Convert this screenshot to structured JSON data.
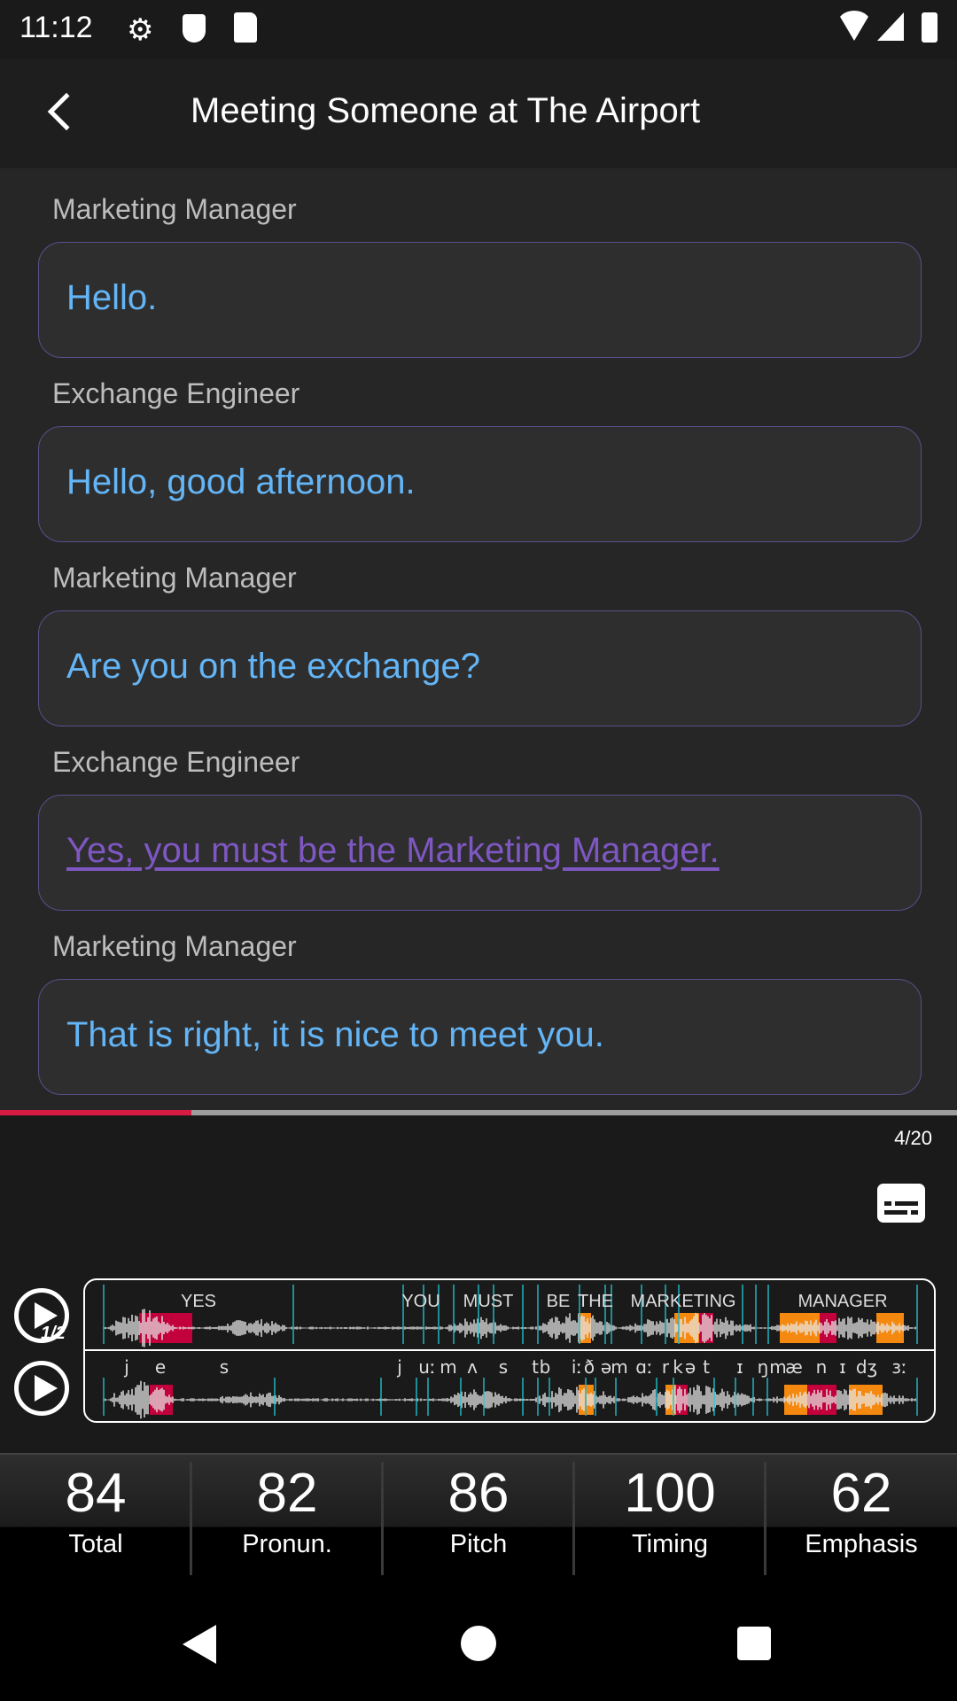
{
  "status_bar": {
    "time": "11:12",
    "icons": [
      "gear-icon",
      "shield-icon",
      "sd-card-icon",
      "wifi-icon",
      "signal-icon",
      "battery-icon"
    ]
  },
  "header": {
    "title": "Meeting Someone at The Airport",
    "back_icon": "chevron-left-icon"
  },
  "dialogue": [
    {
      "speaker": "Marketing Manager",
      "text": "Hello.",
      "active": false
    },
    {
      "speaker": "Exchange Engineer",
      "text": "Hello, good afternoon.",
      "active": false
    },
    {
      "speaker": "Marketing Manager",
      "text": "Are you on the exchange?",
      "active": false
    },
    {
      "speaker": "Exchange Engineer",
      "text": "Yes, you must be the Marketing Manager.",
      "active": true
    },
    {
      "speaker": "Marketing Manager",
      "text": "That is right, it is nice to meet you.",
      "active": false
    }
  ],
  "progress": {
    "current": 4,
    "total": 20,
    "label": "4/20",
    "fraction": 0.2
  },
  "playback": {
    "speed_label": "1/2"
  },
  "waveform": {
    "words": [
      "YES",
      "YOU",
      "MUST",
      "BE",
      "THE",
      "MARKETING",
      "MANAGER"
    ],
    "phonemes": [
      "j",
      "e",
      "s",
      "j",
      "uː",
      "m",
      "ʌ",
      "s",
      "t",
      "b",
      "iː",
      "ð",
      "ə",
      "m",
      "ɑː",
      "r",
      "k",
      "ə",
      "t",
      "ɪ",
      "ŋ",
      "m",
      "æ",
      "n",
      "ɪ",
      "dʒ",
      "ɜː"
    ]
  },
  "scores": [
    {
      "value": "84",
      "label": "Total"
    },
    {
      "value": "82",
      "label": "Pronun."
    },
    {
      "value": "86",
      "label": "Pitch"
    },
    {
      "value": "100",
      "label": "Timing"
    },
    {
      "value": "62",
      "label": "Emphasis"
    }
  ],
  "colors": {
    "text": "#64b5f6",
    "active": "#7e57c2",
    "progress": "#d81b43",
    "error": "#c2003c",
    "warning": "#f5890f",
    "marker": "#1fb5c0"
  }
}
